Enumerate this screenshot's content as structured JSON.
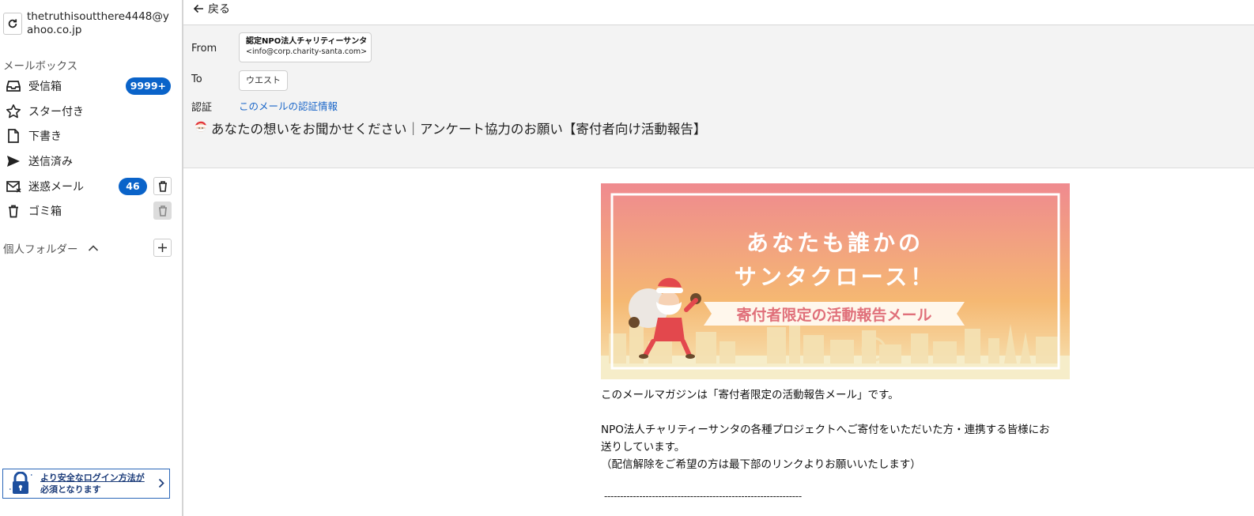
{
  "account": {
    "email": "thetruthisoutthere4448@yahoo.co.jp"
  },
  "mailbox": {
    "section_label": "メールボックス",
    "items": [
      {
        "label": "受信箱",
        "badge": "9999+",
        "icon": "inbox-icon"
      },
      {
        "label": "スター付き",
        "icon": "star-icon"
      },
      {
        "label": "下書き",
        "icon": "draft-icon"
      },
      {
        "label": "送信済み",
        "icon": "send-icon"
      },
      {
        "label": "迷惑メール",
        "badge": "46",
        "icon": "spam-icon"
      },
      {
        "label": "ゴミ箱",
        "icon": "trash-icon"
      }
    ]
  },
  "personal_folders": {
    "label": "個人フォルダー"
  },
  "secure_login_banner": {
    "line1": "より安全なログイン方法が",
    "line2": "必須となります"
  },
  "toolbar": {
    "back_label": "戻る"
  },
  "message": {
    "from_label": "From",
    "from_name": "認定NPO法人チャリティーサンタ",
    "from_address": "<info@corp.charity-santa.com>",
    "to_label": "To",
    "to_value": "ウエスト",
    "auth_label": "認証",
    "auth_link": "このメールの認証情報",
    "subject": "あなたの想いをお聞かせください｜アンケート協力のお願い【寄付者向け活動報告】"
  },
  "banner": {
    "headline_line1": "あなたも誰かの",
    "headline_line2": "サンタクロース！",
    "ribbon": "寄付者限定の活動報告メール"
  },
  "body": {
    "p1": "このメールマガジンは「寄付者限定の活動報告メール」です。",
    "p2a": "NPO法人チャリティーサンタの各種プロジェクトへご寄付をいただいた方・連携する皆様にお",
    "p2b": "送りしています。",
    "p3": "（配信解除をご希望の方は最下部のリンクよりお願いいたします）",
    "divider": "--------------------------------------------------------------"
  },
  "colors": {
    "accent_blue": "#0a63c9",
    "link_blue": "#1a66c8",
    "banner_top": "#ef8a8f",
    "banner_bottom": "#f7e9c2",
    "ribbon_text": "#e0707a"
  }
}
